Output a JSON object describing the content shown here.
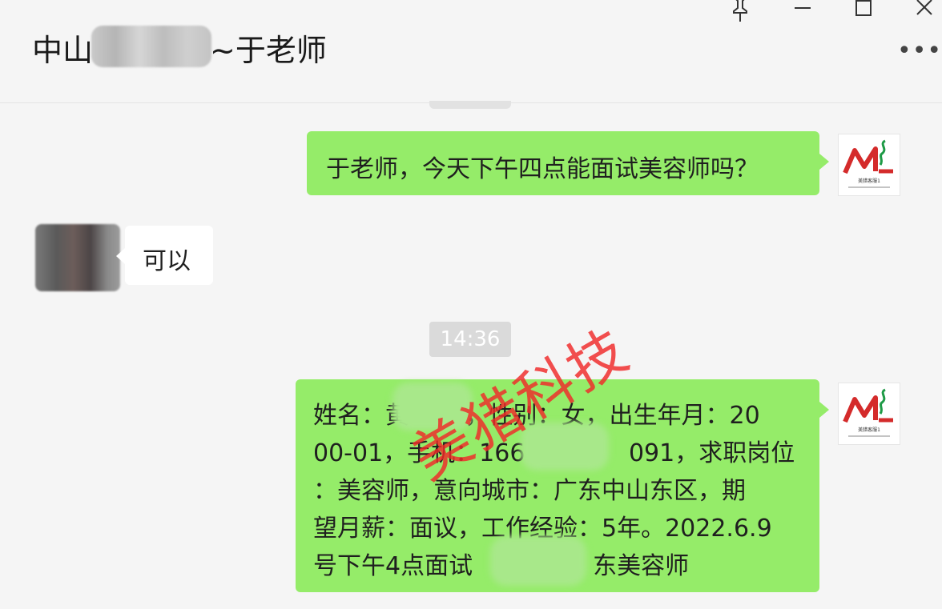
{
  "window": {
    "title_prefix": "中山",
    "title_suffix": "~于老师",
    "controls": {
      "pin": "⚲",
      "minimize": "—",
      "maximize": "☐",
      "close": "✕"
    },
    "more": "•••"
  },
  "messages": [
    {
      "side": "right",
      "text": "于老师，今天下午四点能面试美容师吗？"
    },
    {
      "side": "left",
      "text": "可以"
    },
    {
      "type": "timestamp",
      "text": "14:36"
    },
    {
      "side": "right",
      "lines": [
        "姓名：黄  　　，性别：女，出生年月：20",
        "00-01，手机：166　　　　 091，求职岗位",
        "：美容师，意向城市：广东中山东区，期",
        "望月薪：面议，工作经验：5年。2022.6.9",
        "号下午4点面试　　　　　东美容师"
      ]
    }
  ],
  "watermark": "美猎科技",
  "avatar": {
    "logo_caption": "美猎客服1"
  },
  "colors": {
    "bubble_green": "#95ec69",
    "bubble_white": "#ffffff",
    "background": "#f5f5f5",
    "watermark": "#f02828",
    "logo_red": "#d42b2b",
    "logo_green": "#1e9a46"
  }
}
